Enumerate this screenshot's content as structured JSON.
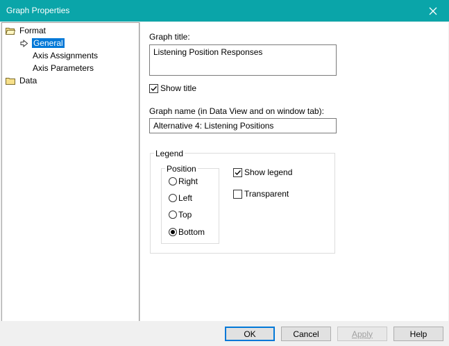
{
  "window": {
    "title": "Graph Properties"
  },
  "tree": {
    "format": "Format",
    "general": "General",
    "axis_assignments": "Axis Assignments",
    "axis_parameters": "Axis Parameters",
    "data": "Data"
  },
  "general": {
    "graph_title_label": "Graph title:",
    "graph_title_value": "Listening Position Responses",
    "show_title_label": "Show title",
    "show_title_checked": true,
    "graph_name_label": "Graph name (in Data View and on window tab):",
    "graph_name_value": "Alternative 4: Listening Positions"
  },
  "legend": {
    "group_label": "Legend",
    "position_label": "Position",
    "positions": [
      "Right",
      "Left",
      "Top",
      "Bottom"
    ],
    "selected_position": "Bottom",
    "show_legend_label": "Show legend",
    "show_legend_checked": true,
    "transparent_label": "Transparent",
    "transparent_checked": false
  },
  "buttons": {
    "ok": "OK",
    "cancel": "Cancel",
    "apply": "Apply",
    "help": "Help"
  },
  "colors": {
    "titlebar": "#0aa5a9",
    "selection": "#0078d7"
  }
}
